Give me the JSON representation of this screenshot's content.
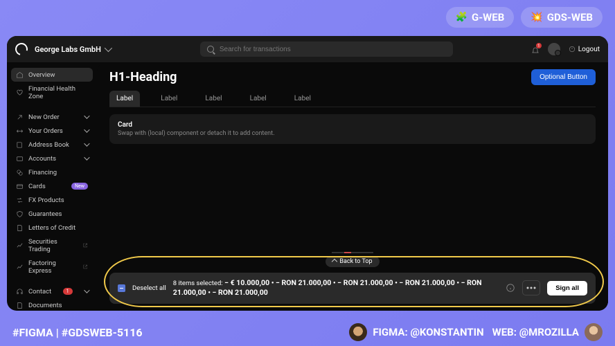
{
  "top_pills": {
    "gweb": "G-WEB",
    "gdsweb": "GDS-WEB"
  },
  "header": {
    "company": "George Labs GmbH",
    "search_placeholder": "Search for transactions",
    "notification_count": "1",
    "logout": "Logout"
  },
  "sidebar": {
    "items": [
      {
        "id": "overview",
        "label": "Overview",
        "icon": "home",
        "active": true
      },
      {
        "id": "health",
        "label": "Financial Health Zone",
        "icon": "heart"
      },
      {
        "divider": true
      },
      {
        "id": "new-order",
        "label": "New Order",
        "icon": "arrow-up-right",
        "expandable": true
      },
      {
        "id": "your-orders",
        "label": "Your Orders",
        "icon": "transfer",
        "expandable": true
      },
      {
        "id": "address-book",
        "label": "Address Book",
        "icon": "book",
        "expandable": true
      },
      {
        "id": "accounts",
        "label": "Accounts",
        "icon": "wallet",
        "expandable": true
      },
      {
        "id": "financing",
        "label": "Financing",
        "icon": "coins"
      },
      {
        "id": "cards",
        "label": "Cards",
        "icon": "card",
        "badge": "New"
      },
      {
        "id": "fx",
        "label": "FX Products",
        "icon": "exchange"
      },
      {
        "id": "guarantees",
        "label": "Guarantees",
        "icon": "shield"
      },
      {
        "id": "letters",
        "label": "Letters of Credit",
        "icon": "document"
      },
      {
        "id": "securities",
        "label": "Securities Trading",
        "icon": "chart",
        "external": true
      },
      {
        "id": "factoring",
        "label": "Factoring Express",
        "icon": "chart",
        "external": true
      },
      {
        "divider": true
      },
      {
        "id": "contact",
        "label": "Contact",
        "icon": "headset",
        "badge": "1",
        "badge_red": true,
        "expandable": true
      },
      {
        "id": "documents",
        "label": "Documents",
        "icon": "document"
      }
    ]
  },
  "main": {
    "heading": "H1-Heading",
    "optional_button": "Optional Button",
    "tabs": [
      "Label",
      "Label",
      "Label",
      "Label",
      "Label"
    ],
    "card": {
      "title": "Card",
      "description": "Swap with (local) component or detach it to add content."
    },
    "back_to_top": "Back to Top"
  },
  "selection": {
    "deselect": "Deselect all",
    "count_prefix": "8 items selected:",
    "amounts": "− € 10.000,00 • − RON 21.000,00 • − RON 21.000,00 • − RON 21.000,00 • − RON 21.000,00 • − RON 21.000,00",
    "sign": "Sign all"
  },
  "footer": {
    "left": "#FIGMA | #GDSWEB-5116",
    "credit1": "FIGMA: @KONSTANTIN",
    "credit2": "WEB: @MROZILLA"
  }
}
